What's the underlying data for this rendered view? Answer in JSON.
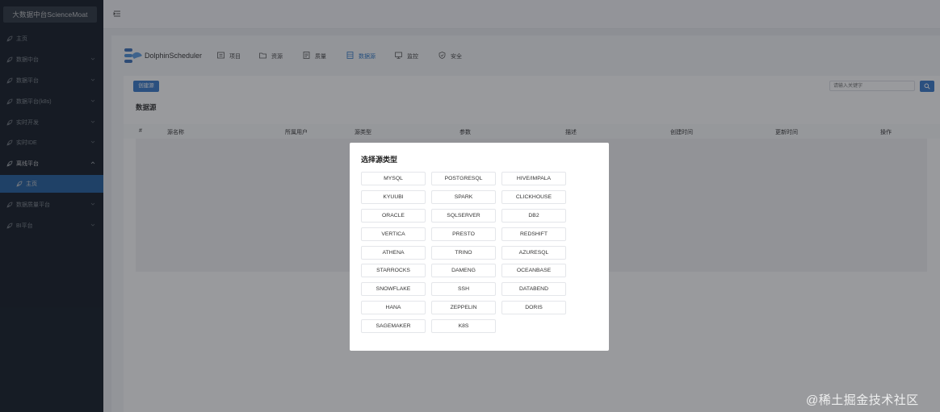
{
  "sidebar": {
    "brand": "大数据中台ScienceMoat",
    "items": [
      {
        "label": "主页",
        "chevron": ""
      },
      {
        "label": "数据中台",
        "chevron": "down"
      },
      {
        "label": "数据平台",
        "chevron": "down"
      },
      {
        "label": "数据平台(k8s)",
        "chevron": "down"
      },
      {
        "label": "实时开发",
        "chevron": "down"
      },
      {
        "label": "实时IDE",
        "chevron": "down"
      },
      {
        "label": "离线平台",
        "chevron": "up"
      },
      {
        "label": "主页",
        "chevron": ""
      },
      {
        "label": "数据质量平台",
        "chevron": "down"
      },
      {
        "label": "BI平台",
        "chevron": "down"
      }
    ]
  },
  "app": {
    "name": "DolphinScheduler",
    "nav": [
      {
        "label": "项目",
        "icon": "project-icon"
      },
      {
        "label": "资源",
        "icon": "folder-icon"
      },
      {
        "label": "质量",
        "icon": "document-icon"
      },
      {
        "label": "数据源",
        "icon": "database-icon"
      },
      {
        "label": "监控",
        "icon": "monitor-icon"
      },
      {
        "label": "安全",
        "icon": "shield-icon"
      }
    ],
    "active_nav": "数据源"
  },
  "content": {
    "create_button": "创建源",
    "search_placeholder": "请输入关键字",
    "section_title": "数据源",
    "columns": [
      "#",
      "源名称",
      "所属用户",
      "源类型",
      "参数",
      "描述",
      "创建时间",
      "更新时间",
      "操作"
    ]
  },
  "modal": {
    "title": "选择源类型",
    "types": [
      "MYSQL",
      "POSTGRESQL",
      "HIVE/IMPALA",
      "KYUUBI",
      "SPARK",
      "CLICKHOUSE",
      "ORACLE",
      "SQLSERVER",
      "DB2",
      "VERTICA",
      "PRESTO",
      "REDSHIFT",
      "ATHENA",
      "TRINO",
      "AZURESQL",
      "STARROCKS",
      "DAMENG",
      "OCEANBASE",
      "SNOWFLAKE",
      "SSH",
      "DATABEND",
      "HANA",
      "ZEPPELIN",
      "DORIS",
      "SAGEMAKER",
      "K8S"
    ]
  },
  "watermark": "@稀土掘金技术社区",
  "colors": {
    "accent": "#2f78c6",
    "sidebar_bg": "#1b2532",
    "overlay": "#1c2026"
  }
}
